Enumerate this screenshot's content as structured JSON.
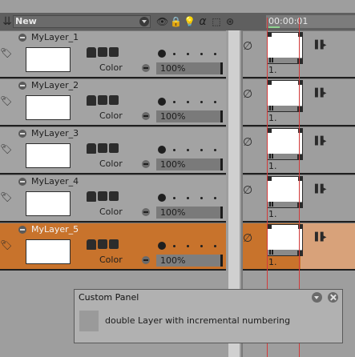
{
  "header": {
    "collapse_all_icon": "chevron-down-double-icon",
    "layer_set_name": "New",
    "toggles": [
      "eye-icon",
      "lock-icon",
      "light-bulb-icon",
      "alpha-icon",
      "selection-icon",
      "onion-skin-icon"
    ],
    "timecode": "00:00:01"
  },
  "layers": [
    {
      "name": "MyLayer_1",
      "color_label": "Color",
      "opacity": "100%",
      "frame": "1.",
      "selected": false
    },
    {
      "name": "MyLayer_2",
      "color_label": "Color",
      "opacity": "100%",
      "frame": "1.",
      "selected": false
    },
    {
      "name": "MyLayer_3",
      "color_label": "Color",
      "opacity": "100%",
      "frame": "1.",
      "selected": false
    },
    {
      "name": "MyLayer_4",
      "color_label": "Color",
      "opacity": "100%",
      "frame": "1.",
      "selected": false
    },
    {
      "name": "MyLayer_5",
      "color_label": "Color",
      "opacity": "100%",
      "frame": "1.",
      "selected": true
    }
  ],
  "colors": {
    "selected_layer": "#c8732c",
    "playhead": "#d23a3a"
  },
  "panel": {
    "title": "Custom Panel",
    "button_text": "double Layer with incremental numbering"
  }
}
